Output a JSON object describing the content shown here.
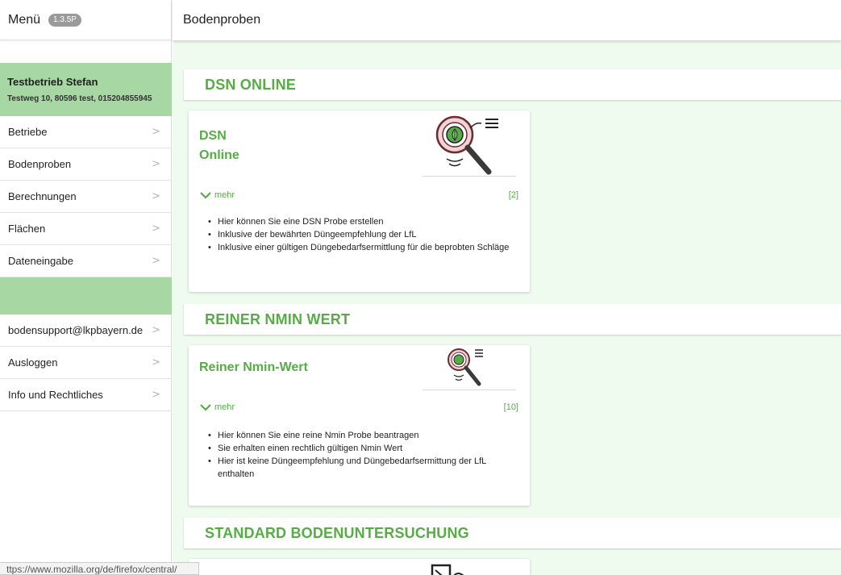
{
  "sidebar": {
    "menu_title": "Menü",
    "version": "1.3.5P",
    "company_name": "Testbetrieb Stefan",
    "company_address": "Testweg 10, 80596 test, 015204855945",
    "items": [
      {
        "label": "Betriebe"
      },
      {
        "label": "Bodenproben"
      },
      {
        "label": "Berechnungen"
      },
      {
        "label": "Flächen"
      },
      {
        "label": "Dateneingabe"
      }
    ],
    "items_2": [
      {
        "label": "bodensupport@lkpbayern.de"
      },
      {
        "label": "Ausloggen"
      },
      {
        "label": "Info und Rechtliches"
      }
    ]
  },
  "header": {
    "title": "Bodenproben"
  },
  "sections": [
    {
      "title": "DSN ONLINE",
      "card": {
        "title_line1": "DSN",
        "title_line2": "Online",
        "mehr": "mehr",
        "count": "[2]",
        "bullets": [
          "Hier können Sie eine DSN Probe erstellen",
          "Inklusive der bewährten Düngeempfehlung der LfL",
          "Inklusive einer gültigen Düngebedarfsermittlung für die beprobten Schläge"
        ]
      }
    },
    {
      "title": "REINER NMIN WERT",
      "card": {
        "title_line1": "Reiner Nmin-Wert",
        "mehr": "mehr",
        "count": "[10]",
        "bullets": [
          "Hier können Sie eine reine Nmin Probe beantragen",
          "Sie erhalten einen rechtlich gültigen Nmin Wert",
          "Hier ist keine Düngeempfehlung und Düngebedarfsermittung der LfL enthalten"
        ]
      }
    },
    {
      "title": "STANDARD BODENUNTERSUCHUNG"
    }
  ],
  "status_bar": {
    "url": "ttps://www.mozilla.org/de/firefox/central/"
  },
  "colors": {
    "accent": "#56ad45",
    "sidebar_green": "#a7d7a2",
    "main_bg": "#f0fbef"
  }
}
